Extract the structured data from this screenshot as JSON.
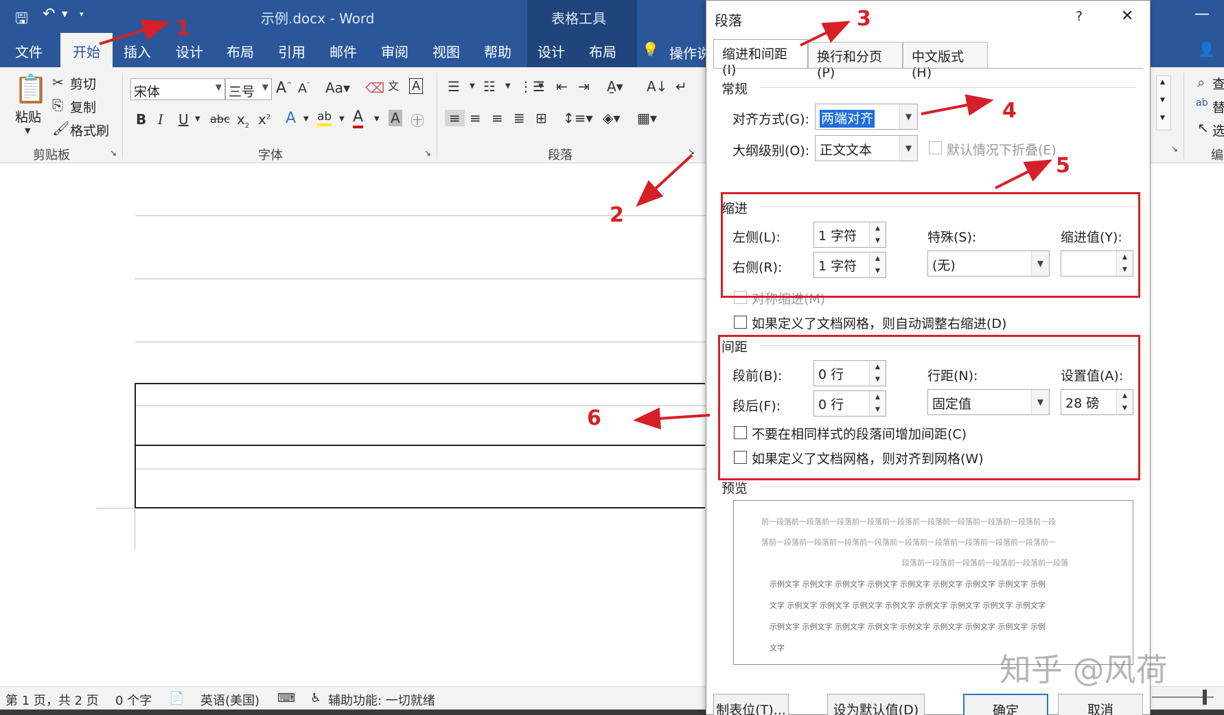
{
  "titlebar": {
    "doc_title": "示例.docx  -  Word",
    "table_tools": "表格工具"
  },
  "ribbon_tabs": [
    "文件",
    "开始",
    "插入",
    "设计",
    "布局",
    "引用",
    "邮件",
    "审阅",
    "视图",
    "帮助",
    "设计",
    "布局"
  ],
  "tell_me": "操作说",
  "clipboard": {
    "paste": "粘贴",
    "cut": "剪切",
    "copy": "复制",
    "format_painter": "格式刷",
    "group_label": "剪贴板"
  },
  "font": {
    "font_name": "宋体",
    "font_size": "三号",
    "group_label": "字体"
  },
  "paragraph_group_label": "段落",
  "right_ribbon": {
    "find": "查",
    "replace": "替",
    "select": "选",
    "edit": "编"
  },
  "statusbar": {
    "page": "第 1 页，共 2 页",
    "words": "0 个字",
    "language": "英语(美国)",
    "accessibility": "辅助功能: 一切就绪"
  },
  "dialog": {
    "title": "段落",
    "help": "?",
    "close": "✕",
    "tabs": [
      "缩进和间距(I)",
      "换行和分页(P)",
      "中文版式(H)"
    ],
    "general": {
      "title": "常规",
      "alignment_label": "对齐方式(G):",
      "alignment_value": "两端对齐",
      "outline_label": "大纲级别(O):",
      "outline_value": "正文文本",
      "collapse_label": "默认情况下折叠(E)"
    },
    "indent": {
      "title": "缩进",
      "left_label": "左侧(L):",
      "left_value": "1 字符",
      "right_label": "右侧(R):",
      "right_value": "1 字符",
      "special_label": "特殊(S):",
      "special_value": "(无)",
      "by_label": "缩进值(Y):",
      "by_value": "",
      "mirror_label": "对称缩进(M)",
      "auto_adjust_label": "如果定义了文档网格，则自动调整右缩进(D)"
    },
    "spacing": {
      "title": "间距",
      "before_label": "段前(B):",
      "before_value": "0 行",
      "after_label": "段后(F):",
      "after_value": "0 行",
      "line_label": "行距(N):",
      "line_value": "固定值",
      "at_label": "设置值(A):",
      "at_value": "28 磅",
      "no_space_label": "不要在相同样式的段落间增加间距(C)",
      "snap_grid_label": "如果定义了文档网格，则对齐到网格(W)"
    },
    "preview": {
      "title": "预览",
      "prev_lines": [
        "前一段落前一段落前一段落前一段落前一段落前一段落前一段落前一段落前一段落前一段",
        "落前一段落前一段落前一段落前一段落前一段落前一段落前一段落前一段落前一段落前一",
        "段落前一段落前一段落前一段落前一段落前一段落"
      ],
      "sample_lines": [
        "示例文字  示例文字  示例文字  示例文字  示例文字  示例文字  示例文字  示例文字  示例",
        "文字  示例文字  示例文字  示例文字  示例文字  示例文字  示例文字  示例文字  示例文字",
        "示例文字  示例文字  示例文字  示例文字  示例文字  示例文字  示例文字  示例文字  示例",
        "文字"
      ]
    },
    "buttons": {
      "tabs": "制表位(T)...",
      "set_default": "设为默认值(D)",
      "ok": "确定",
      "cancel": "取消"
    }
  },
  "annotations": [
    "1",
    "2",
    "3",
    "4",
    "5",
    "6"
  ],
  "watermark": "知乎 @风荷",
  "colors": {
    "ribbon_blue": "#2b579a",
    "annotation_red": "#d61f26",
    "selection_blue": "#1e6fd9"
  }
}
